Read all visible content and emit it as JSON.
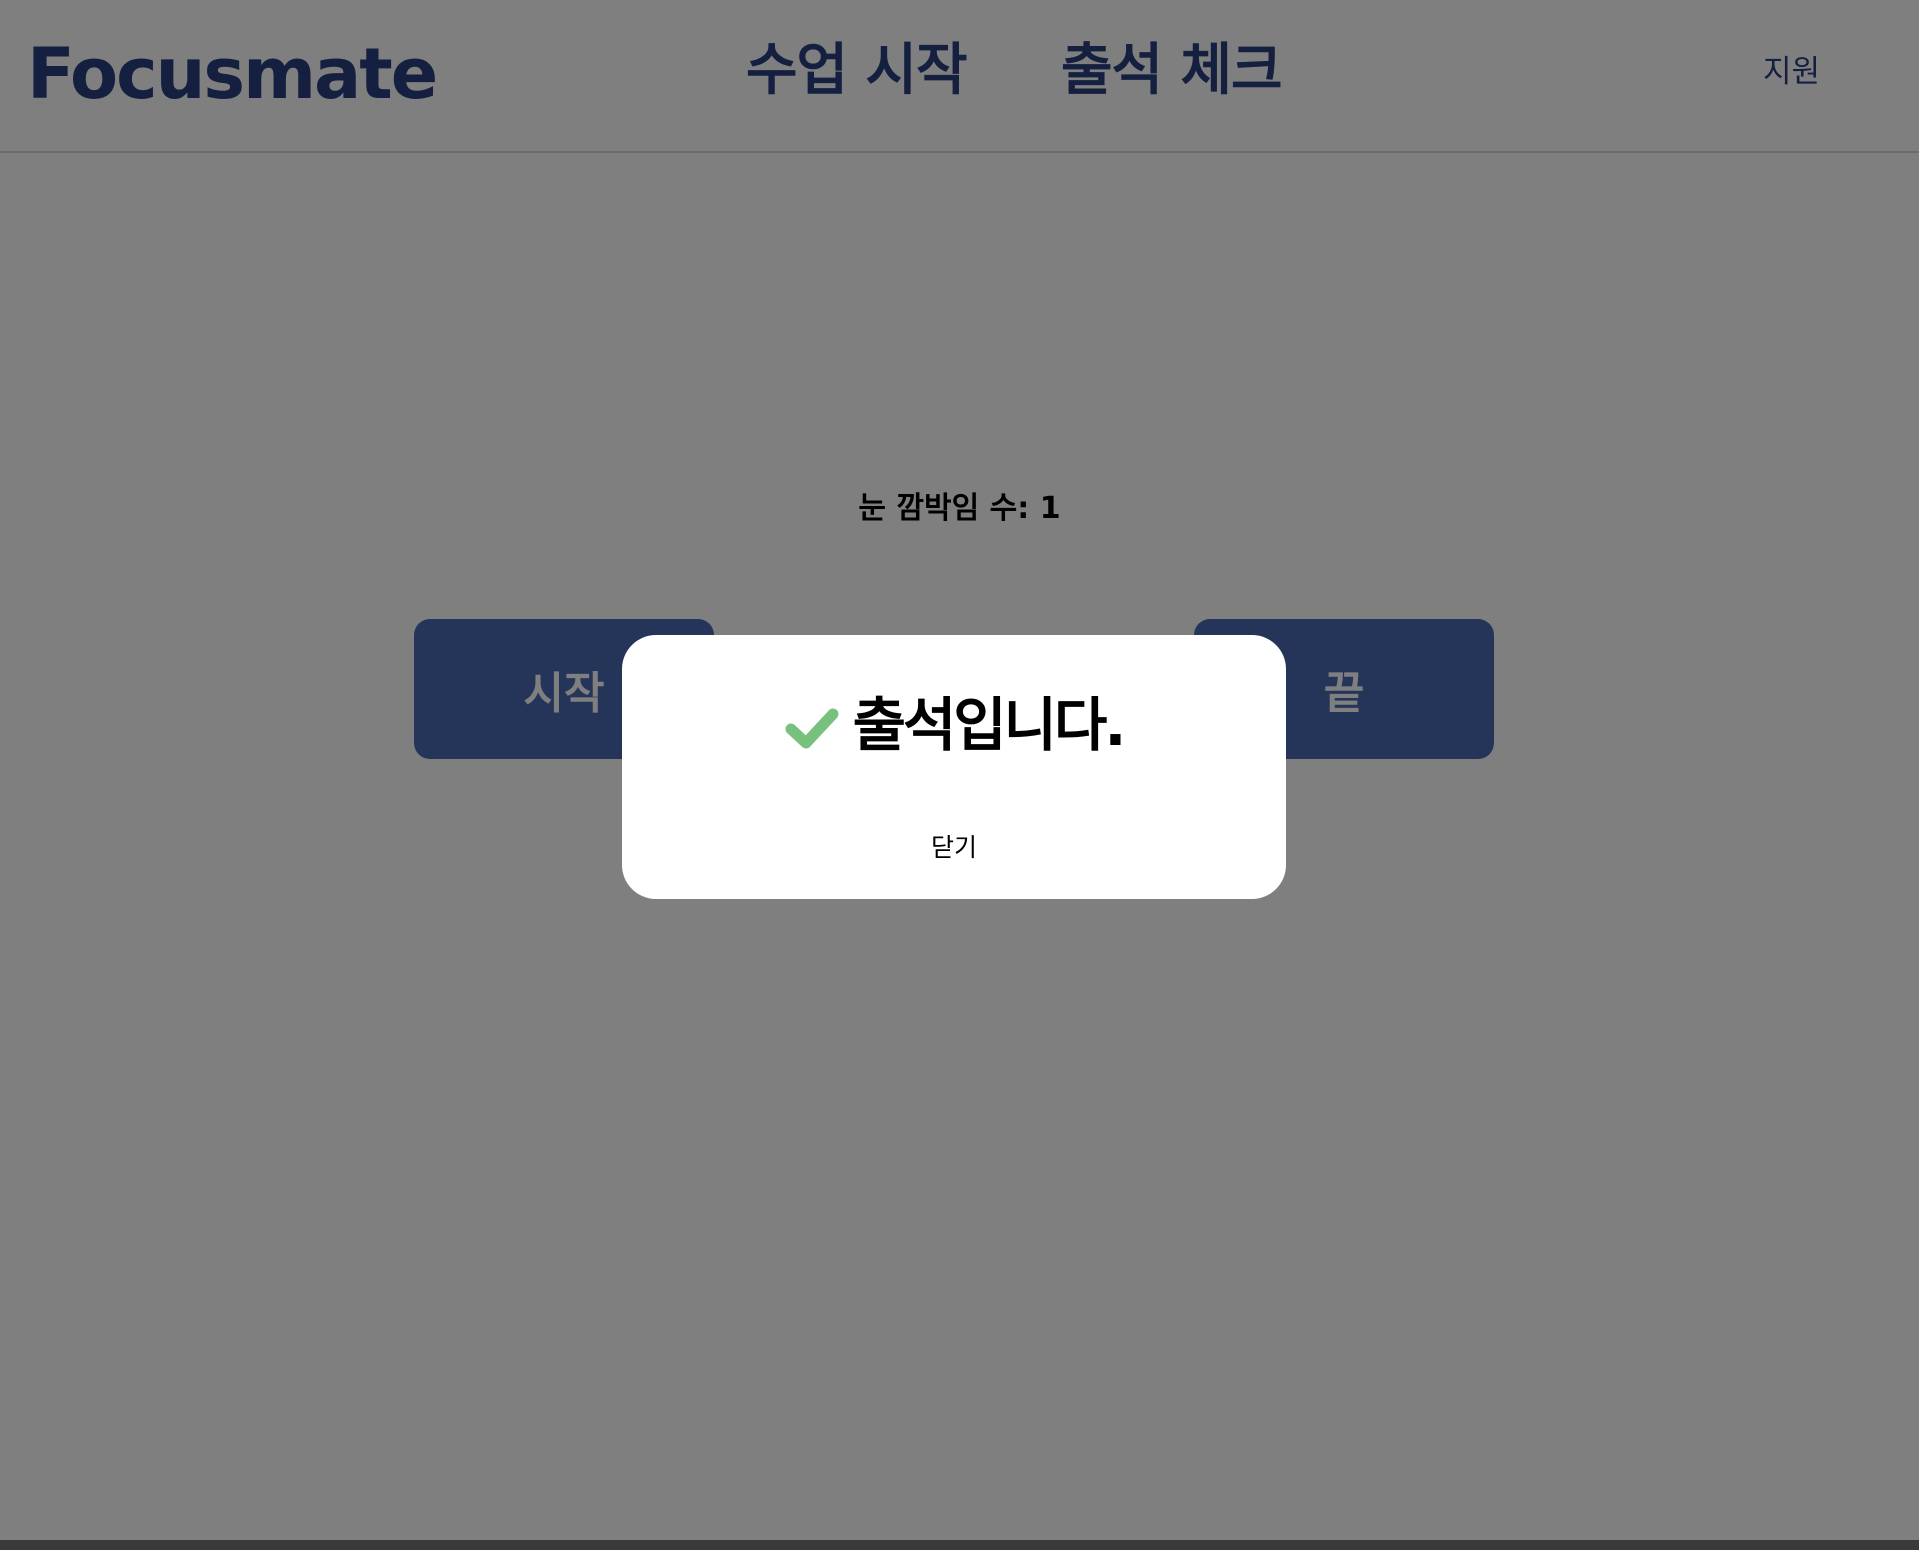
{
  "header": {
    "logo": "Focusmate",
    "nav": {
      "start_class": "수업 시작",
      "attendance_check": "출석 체크"
    },
    "support": "지원"
  },
  "main": {
    "blink_count_label": "눈 깜박임 수: 1",
    "start_button": "시작",
    "end_button": "끝"
  },
  "modal": {
    "icon": "check-icon",
    "message": "출석입니다.",
    "close_label": "닫기"
  },
  "colors": {
    "brand": "#2a4183",
    "button_bg": "#4a6ab5",
    "overlay": "rgba(0,0,0,0.5)",
    "check": "#78c07e"
  }
}
